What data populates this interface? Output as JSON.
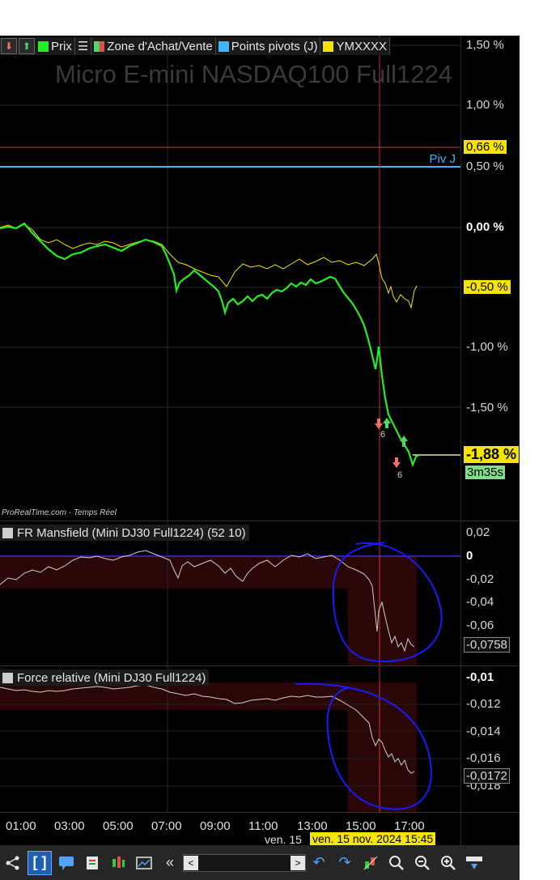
{
  "main": {
    "legend": {
      "price": "Prix",
      "zone": "Zone d'Achat/Vente",
      "pivots": "Points pivots (J)",
      "ym": "YMXXXX"
    },
    "watermark": "Micro E-mini NASDAQ100 Full1224",
    "pivot_label": "Piv J",
    "footer_credit": "ProRealTime.com - Temps Réel",
    "signal_count_1": "6",
    "signal_count_2": "6",
    "y_ticks": [
      "1,50 %",
      "1,00 %",
      "0,50 %",
      "0,00 %",
      "-1,00 %",
      "-1,50 %"
    ],
    "tag_pivot": "0,66 %",
    "tag_ym": "-0,50 %",
    "tag_last": "-1,88 %",
    "countdown": "3m35s",
    "colors": {
      "price": "#22ee22",
      "ym": "#f5e400",
      "pivot": "#3fb4ff",
      "cursor": "#c0392b"
    }
  },
  "mansfield": {
    "title": "FR Mansfield (Mini DJ30 Full1224) (52 10)",
    "y_ticks": [
      "0,02",
      "0",
      "-0,02",
      "-0,04",
      "-0,06"
    ],
    "last_value": "-0,0758"
  },
  "rs": {
    "title": "Force relative (Mini DJ30 Full1224)",
    "y_ticks": [
      "-0,01",
      "-0,012",
      "-0,014",
      "-0,016",
      "-0,018"
    ],
    "last_value": "-0,0172"
  },
  "xaxis": {
    "ticks": [
      "01:00",
      "03:00",
      "05:00",
      "07:00",
      "09:00",
      "11:00",
      "13:00",
      "15:00",
      "17:00"
    ],
    "day_label": "ven. 15",
    "cursor_label": "ven. 15 nov. 2024 15:45"
  },
  "toolbar": {
    "scroll_left": "«"
  }
}
